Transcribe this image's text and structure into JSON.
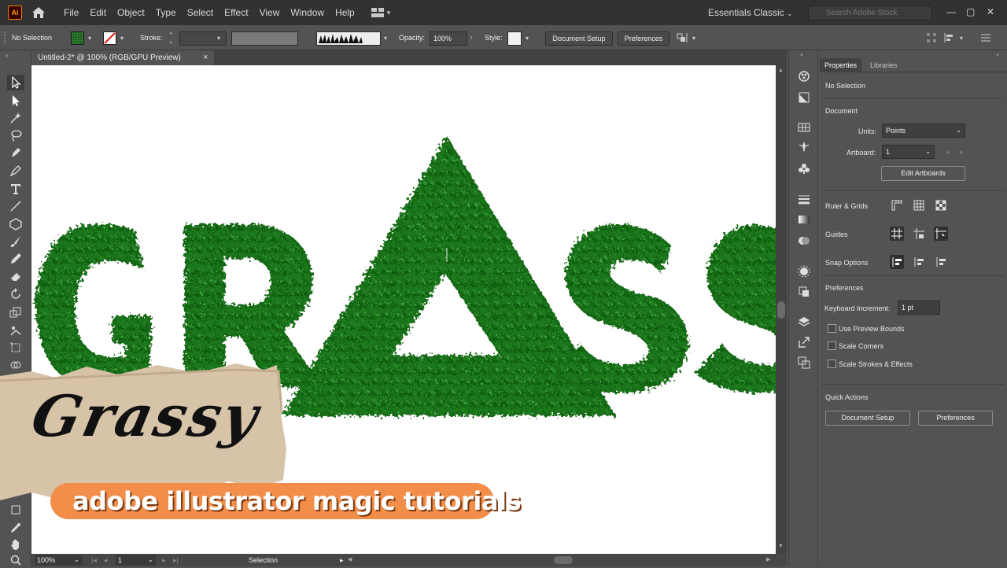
{
  "app": {
    "logo": "Ai"
  },
  "menu": [
    "File",
    "Edit",
    "Object",
    "Type",
    "Select",
    "Effect",
    "View",
    "Window",
    "Help"
  ],
  "workspace": "Essentials Classic",
  "search": {
    "placeholder": "Search Adobe Stock"
  },
  "control_bar": {
    "selection_label": "No Selection",
    "stroke_label": "Stroke:",
    "opacity_label": "Opacity:",
    "opacity_value": "100%",
    "style_label": "Style:",
    "document_setup_btn": "Document Setup",
    "preferences_btn": "Preferences"
  },
  "document_tab": {
    "title": "Untitled-2* @ 100% (RGB/GPU Preview)",
    "close": "×"
  },
  "canvas": {
    "artwork_text": "GRASS",
    "colors": {
      "grass": "#1e7a1e",
      "grass_dark": "#0f5a10",
      "grass_light": "#3aa33a"
    }
  },
  "overlay": {
    "title": "Grassy",
    "subtitle": "adobe illustrator magic tutorials",
    "pill_color": "#f28d4a",
    "kraft_color": "#d6c3a8"
  },
  "status_bar": {
    "zoom": "100%",
    "artboard": "1",
    "tool": "Selection"
  },
  "properties": {
    "tabs": [
      "Properties",
      "Libraries"
    ],
    "no_selection": "No Selection",
    "document_header": "Document",
    "units_label": "Units:",
    "units_value": "Points",
    "artboard_label": "Artboard:",
    "artboard_value": "1",
    "edit_artboards_btn": "Edit Artboards",
    "ruler_grids_label": "Ruler & Grids",
    "guides_label": "Guides",
    "snap_options_label": "Snap Options",
    "preferences_header": "Preferences",
    "keyboard_increment_label": "Keyboard Increment:",
    "keyboard_increment_value": "1 pt",
    "use_preview_bounds": "Use Preview Bounds",
    "scale_corners": "Scale Corners",
    "scale_strokes": "Scale Strokes & Effects",
    "quick_actions_header": "Quick Actions",
    "document_setup_btn": "Document Setup",
    "preferences_btn": "Preferences"
  }
}
